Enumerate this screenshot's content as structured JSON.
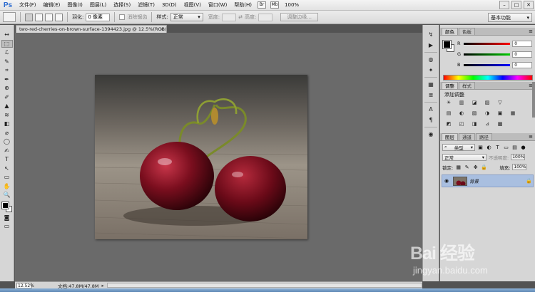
{
  "app": {
    "logo": "Ps",
    "menu": [
      "文件(F)",
      "编辑(E)",
      "图像(I)",
      "图层(L)",
      "选择(S)",
      "滤镜(T)",
      "3D(D)",
      "视图(V)",
      "窗口(W)",
      "帮助(H)"
    ],
    "menu_icons": [
      "Br",
      "Mb"
    ],
    "zoom_menu": "100%",
    "window_controls": [
      "–",
      "□",
      "✕"
    ]
  },
  "options_bar": {
    "feather_label": "羽化:",
    "feather_value": "0 像素",
    "antialias_label": "消除锯齿",
    "style_label": "样式:",
    "style_value": "正常",
    "width_label": "宽度:",
    "height_label": "高度:",
    "refine_edge_button": "调整边缘...",
    "workspace": "基本功能"
  },
  "document": {
    "tab_title": "two-red-cherries-on-brown-surface-1394423.jpg @ 12.5%(RGB/8) *",
    "close": "×",
    "zoom": "12.52%",
    "doc_info": "文档:47.8M/47.8M"
  },
  "tools": [
    "↔",
    "⬚",
    "ℒ",
    "✎",
    "⌗",
    "✒",
    "⊕",
    "✐",
    "▲",
    "≋",
    "◧",
    "⌀",
    "◯",
    "✍",
    "T",
    "↖",
    "▭",
    "✋",
    "🔍"
  ],
  "dock_icons": [
    "↯",
    "▶",
    "◍",
    "✦",
    "▦",
    "≣",
    "A",
    "¶",
    "◉"
  ],
  "color_panel": {
    "tabs": [
      "颜色",
      "色板"
    ],
    "sliders": [
      {
        "label": "R",
        "value": "0",
        "color": "#ff0000"
      },
      {
        "label": "G",
        "value": "0",
        "color": "#00c000"
      },
      {
        "label": "B",
        "value": "0",
        "color": "#0000ff"
      }
    ],
    "menu_icon": "≡"
  },
  "adjustments_panel": {
    "tabs": [
      "调整",
      "样式"
    ],
    "title": "添加调整",
    "icons": [
      "☀",
      "▥",
      "◪",
      "▨",
      "▽",
      "",
      "▤",
      "◐",
      "▧",
      "◑",
      "▣",
      "▦",
      "◩",
      "◰",
      "◨",
      "⊿",
      "▩",
      ""
    ]
  },
  "layers_panel": {
    "tabs": [
      "图层",
      "通道",
      "路径"
    ],
    "kind_label": "类型",
    "blend_mode": "正常",
    "opacity_label": "不透明度:",
    "opacity_value": "100%",
    "lock_label": "锁定:",
    "fill_label": "填充:",
    "fill_value": "100%",
    "layer_name": "背景",
    "eye": "◉",
    "lock": "🔒"
  },
  "watermark": {
    "logo": "Bai 经验",
    "site": "jingyan.baidu.com"
  },
  "colors": {
    "chrome_dark": "#535353",
    "canvas_bg": "#6a6a6a",
    "layer_selected": "#a9bfe0",
    "ps_blue": "#2b6bd0"
  }
}
